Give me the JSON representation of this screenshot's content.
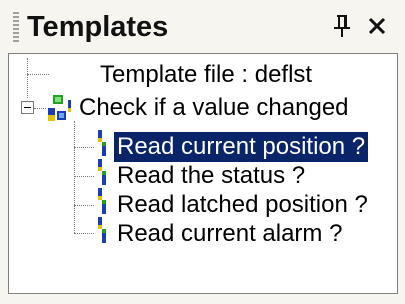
{
  "panel": {
    "title": "Templates",
    "pin_icon": "pin-icon",
    "close_icon": "close-icon",
    "pin_glyph": "⫧",
    "close_glyph": "×"
  },
  "tree": {
    "template_file": "Template file : deflst",
    "root": {
      "label": "Check if a value changed",
      "icon": "function-block-icon",
      "expanded": true,
      "children": [
        {
          "label": "Read current position ?",
          "icon": "step-icon",
          "selected": true
        },
        {
          "label": "Read the status ?",
          "icon": "step-icon",
          "selected": false
        },
        {
          "label": "Read latched position ?",
          "icon": "step-icon",
          "selected": false
        },
        {
          "label": "Read current alarm ?",
          "icon": "step-icon",
          "selected": false
        }
      ]
    }
  },
  "colors": {
    "selection_bg": "#0a246a",
    "selection_fg": "#ffffff",
    "icon_green": "#21a121",
    "icon_blue": "#1b3fb3",
    "icon_yellow": "#e3c000"
  }
}
